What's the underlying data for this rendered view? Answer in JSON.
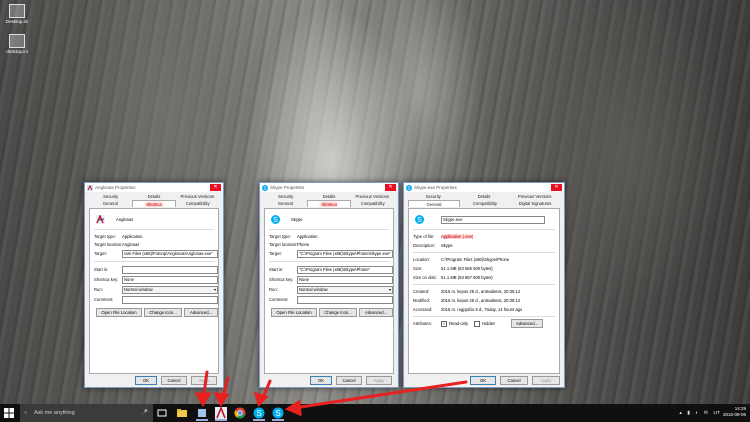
{
  "desktop": {
    "icons": [
      {
        "label": "Desktop.ini",
        "icon": "settings-file-icon"
      },
      {
        "label": "desktop.ini",
        "icon": "settings-file-icon"
      }
    ]
  },
  "dialogs": {
    "anglonas": {
      "title": "Anglonas Properties",
      "tabs_top": [
        "Security",
        "Details",
        "Previous Versions"
      ],
      "tabs_bottom": [
        "General",
        "Shortcut",
        "Compatibility"
      ],
      "name": "Anglonas",
      "target_type_label": "Target type:",
      "target_type": "Application",
      "target_location_label": "Target location:",
      "target_location": "Anglonas",
      "target_label": "Target:",
      "target": "ram Files (x86)\\Fotonp\\Anglonas\\Anglonas.exe\"",
      "start_in_label": "Start in:",
      "start_in": "",
      "shortcut_key_label": "Shortcut key:",
      "shortcut_key": "None",
      "run_label": "Run:",
      "run": "Normal window",
      "comment_label": "Comment:",
      "comment": "",
      "buttons": [
        "Open File Location",
        "Change Icon...",
        "Advanced..."
      ],
      "footer": [
        "OK",
        "Cancel",
        "Apply"
      ]
    },
    "skype_shortcut": {
      "title": "Skype Properties",
      "tabs_top": [
        "Security",
        "Details",
        "Previous Versions"
      ],
      "tabs_bottom": [
        "General",
        "Shortcut",
        "Compatibility"
      ],
      "name": "Skype",
      "target_type_label": "Target type:",
      "target_type": "Application",
      "target_location_label": "Target location:",
      "target_location": "Phone",
      "target_label": "Target:",
      "target": "\"C:\\Program Files (x86)\\Skype\\Phone\\Skype.exe\"",
      "start_in_label": "Start in:",
      "start_in": "\"C:\\Program Files (x86)\\Skype\\Phone\"",
      "shortcut_key_label": "Shortcut key:",
      "shortcut_key": "None",
      "run_label": "Run:",
      "run": "Normal window",
      "comment_label": "Comment:",
      "comment": "",
      "buttons": [
        "Open File Location",
        "Change Icon...",
        "Advanced..."
      ],
      "footer": [
        "OK",
        "Cancel",
        "Apply"
      ]
    },
    "skype_exe": {
      "title": "Skype.exe Properties",
      "tabs_top": [
        "Security",
        "Details",
        "Previous Versions"
      ],
      "tabs_bottom": [
        "General",
        "Compatibility",
        "Digital Signatures"
      ],
      "name": "Skype.exe",
      "type_label": "Type of file:",
      "type": "Application (.exe)",
      "description_label": "Description:",
      "description": "Skype",
      "location_label": "Location:",
      "location": "C:\\Program Files (x86)\\Skype\\Phone",
      "size_label": "Size:",
      "size": "51.1 MB (53 655 600 bytes)",
      "size_on_disk_label": "Size on disk:",
      "size_on_disk": "51.1 MB (53 657 600 bytes)",
      "created_label": "Created:",
      "created": "2015 m. liepos 28 d., antradienis, 20:39:12",
      "modified_label": "Modified:",
      "modified": "2015 m. liepos 28 d., antradienis, 20:39:12",
      "accessed_label": "Accessed:",
      "accessed": "2015 m. rugpjūčio 6 d., Today, 14 hours ago",
      "attributes_label": "Attributes:",
      "readonly_label": "Read-only",
      "hidden_label": "Hidden",
      "advanced": "Advanced...",
      "footer": [
        "OK",
        "Cancel",
        "Apply"
      ]
    }
  },
  "taskbar": {
    "search_placeholder": "Ask me anything",
    "language": "LIT",
    "time": "14:29",
    "date": "2015-08-06"
  },
  "colors": {
    "highlight": "#ff3b3b",
    "arrow": "#e8201f",
    "taskbar": "#101010",
    "skype_blue": "#00aff0"
  }
}
